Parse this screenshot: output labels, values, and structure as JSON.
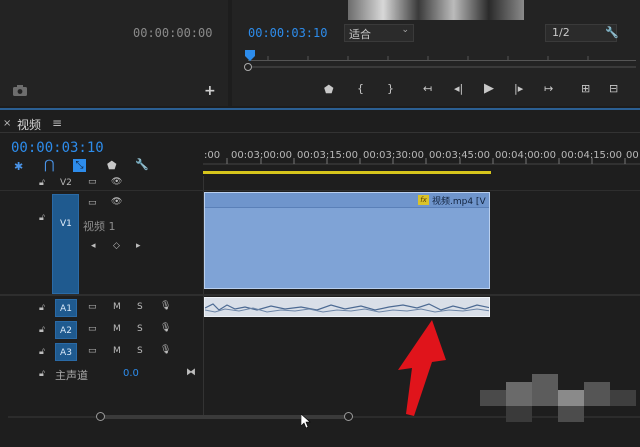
{
  "source_monitor": {
    "timecode": "00:00:00:00"
  },
  "program_monitor": {
    "timecode": "00:00:03:10",
    "fit_select": "适合",
    "resolution_select": "1/2"
  },
  "timeline": {
    "tab_close": "×",
    "tab_title": "视频",
    "tab_menu": "≡",
    "timecode": "00:00:03:10",
    "ruler": [
      ":00",
      "00:03:00:00",
      "00:03:15:00",
      "00:03:30:00",
      "00:03:45:00",
      "00:04:00:00",
      "00:04:15:00",
      "00"
    ],
    "tracks": {
      "v2": "V2",
      "v1": "V1",
      "v1_name": "视频 1",
      "a1": "A1",
      "a2": "A2",
      "a3": "A3",
      "mute": "M",
      "solo": "S",
      "master": "主声道",
      "master_value": "0.0"
    },
    "clip": {
      "fx": "fx",
      "label": "视频.mp4 [V"
    }
  },
  "colors": {
    "accent": "#2d8ceb",
    "video_clip": "#7fa3d6",
    "audio_clip": "#d9dfe8",
    "annotation_arrow": "#e0141b",
    "track_header": "#1f5a8f"
  }
}
